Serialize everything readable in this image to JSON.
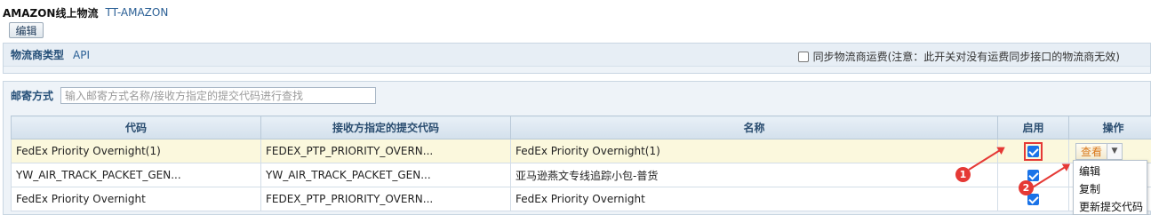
{
  "header": {
    "title": "AMAZON线上物流",
    "code": "TT-AMAZON"
  },
  "toolbar": {
    "edit_label": "编辑"
  },
  "carrier": {
    "label": "物流商类型",
    "value": "API",
    "sync_label": "同步物流商运费(注意：此开关对没有运费同步接口的物流商无效)",
    "sync_checked": false
  },
  "search": {
    "label": "邮寄方式",
    "placeholder": "输入邮寄方式名称/接收方指定的提交代码进行查找"
  },
  "table": {
    "headers": [
      "代码",
      "接收方指定的提交代码",
      "名称",
      "启用",
      "操作"
    ],
    "rows": [
      {
        "code": "FedEx Priority Overnight(1)",
        "submit_code": "FEDEX_PTP_PRIORITY_OVERN...",
        "name": "FedEx Priority Overnight(1)",
        "enabled": true
      },
      {
        "code": "YW_AIR_TRACK_PACKET_GEN...",
        "submit_code": "YW_AIR_TRACK_PACKET_GEN...",
        "name": "亚马逊燕文专线追踪小包-普货",
        "enabled": true
      },
      {
        "code": "FedEx Priority Overnight",
        "submit_code": "FEDEX_PTP_PRIORITY_OVERN...",
        "name": "FedEx Priority Overnight",
        "enabled": true
      }
    ]
  },
  "actions": {
    "view_label": "查看",
    "dropdown_icon": "chevron-down-icon"
  },
  "menu": {
    "items": [
      "编辑",
      "复制",
      "更新提交代码"
    ]
  },
  "annotations": {
    "badge1": "1",
    "badge2": "2",
    "color": "#e53935"
  }
}
